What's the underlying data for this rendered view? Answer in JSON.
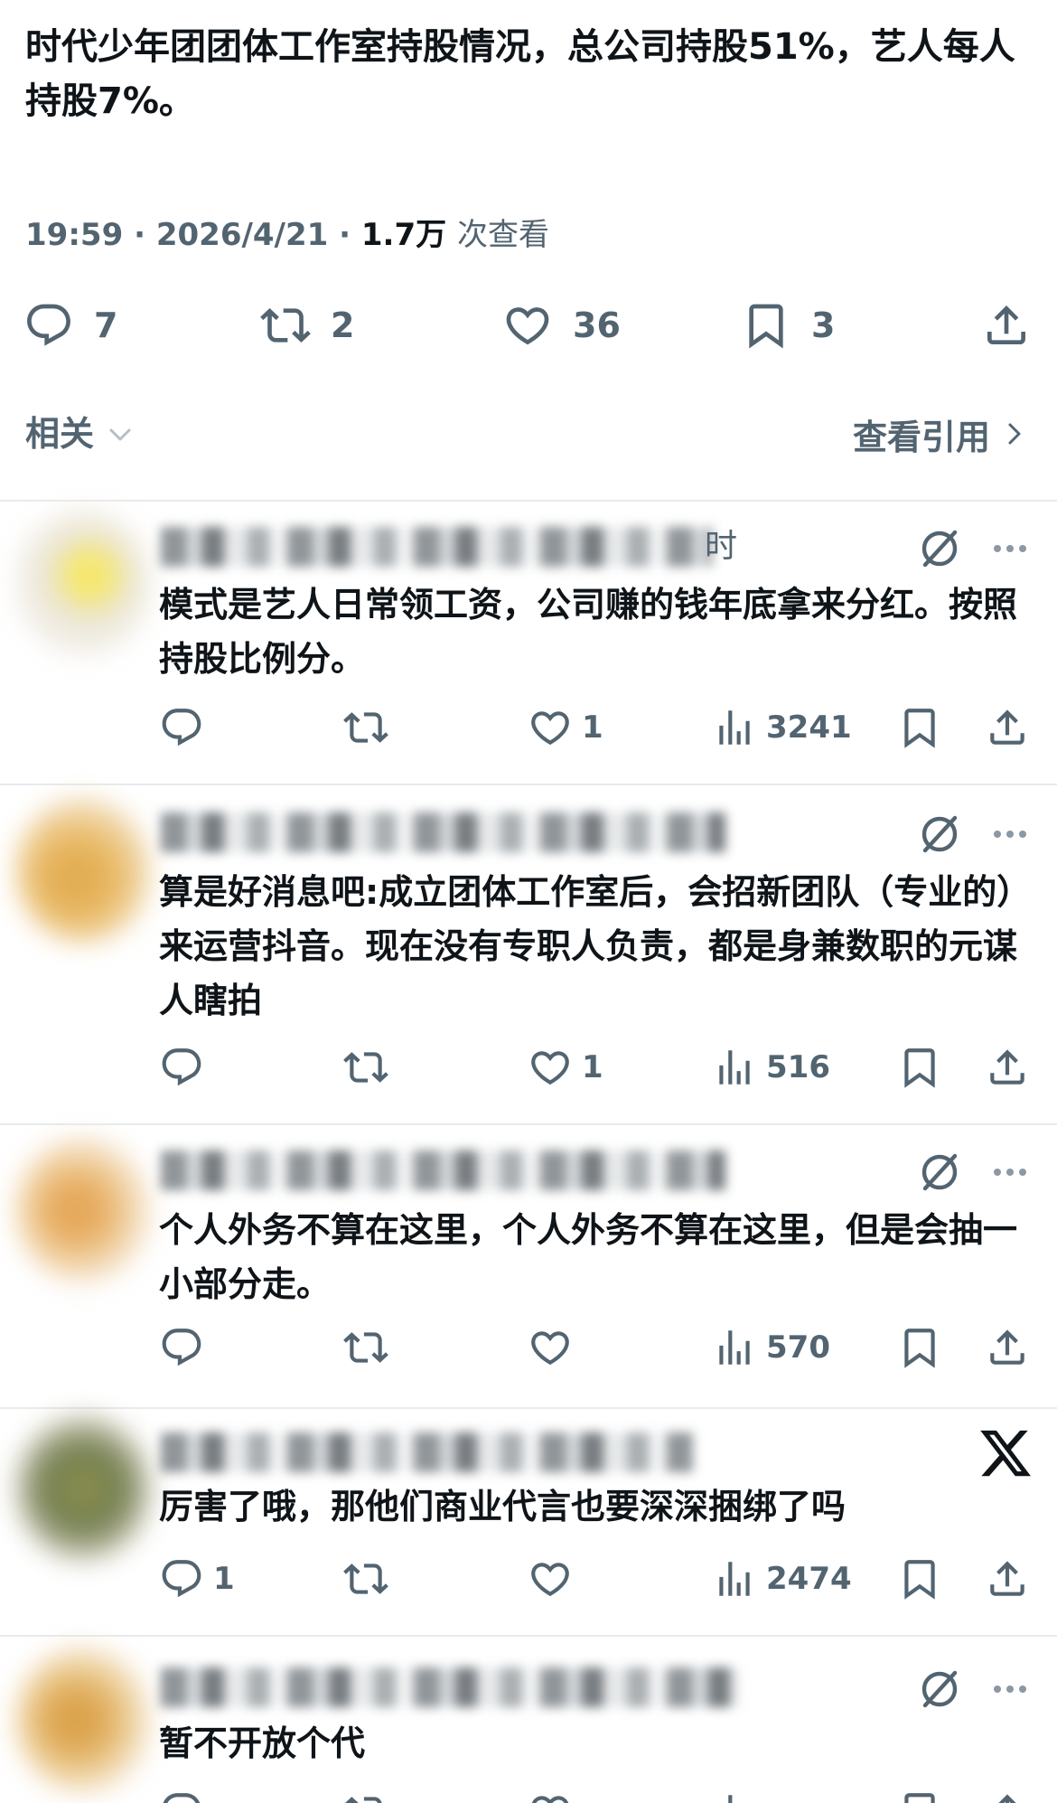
{
  "post": {
    "text": "时代少年团团体工作室持股情况，总公司持股51%，艺人每人持股7%。",
    "time": "19:59",
    "date": "2026/4/21",
    "views": "1.7万",
    "views_label": "次查看",
    "replies": "7",
    "reposts": "2",
    "likes": "36",
    "bookmarks": "3"
  },
  "related": {
    "label": "相关",
    "quotes_link": "查看引用"
  },
  "replies": [
    {
      "name_tail": "时",
      "text": "模式是艺人日常领工资，公司赚的钱年底拿来分红。按照持股比例分。",
      "reply_count": "",
      "like_count": "1",
      "view_count": "3241"
    },
    {
      "name_tail": "",
      "text": "算是好消息吧:成立团体工作室后，会招新团队（专业的）来运营抖音。现在没有专职人负责，都是身兼数职的元谋人瞎拍",
      "reply_count": "",
      "like_count": "1",
      "view_count": "516"
    },
    {
      "name_tail": "",
      "text": "个人外务不算在这里，个人外务不算在这里，但是会抽一小部分走。",
      "reply_count": "",
      "like_count": "",
      "view_count": "570"
    },
    {
      "name_tail": "",
      "text": "厉害了哦，那他们商业代言也要深深捆绑了吗",
      "reply_count": "1",
      "like_count": "",
      "view_count": "2474"
    },
    {
      "name_tail": "",
      "text": "暂不开放个代",
      "reply_count": "",
      "like_count": "",
      "view_count": ""
    }
  ],
  "icons": {
    "reply": "reply-icon",
    "repost": "repost-icon",
    "like": "heart-icon",
    "bookmark": "bookmark-icon",
    "share": "share-icon",
    "views": "views-icon",
    "grok": "grok-icon",
    "more": "more-icon",
    "x": "x-logo-icon"
  },
  "colors": {
    "text": "#0f1419",
    "secondary": "#536471",
    "divider": "#e8ebed"
  }
}
